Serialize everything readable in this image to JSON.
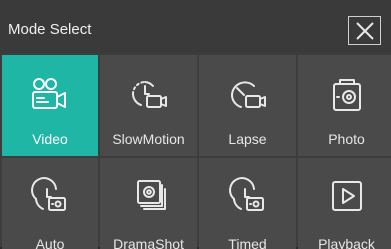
{
  "header": {
    "title": "Mode Select",
    "close_icon": "close-icon"
  },
  "modes": [
    {
      "label": "Video",
      "icon": "video-camera-icon",
      "active": true
    },
    {
      "label": "SlowMotion",
      "icon": "slow-motion-camera-icon",
      "active": false
    },
    {
      "label": "Lapse",
      "icon": "time-lapse-camera-icon",
      "active": false
    },
    {
      "label": "Photo",
      "icon": "photo-camera-icon",
      "active": false
    },
    {
      "label": "Auto",
      "icon": "auto-timer-camera-icon",
      "active": false
    },
    {
      "label": "DramaShot",
      "icon": "drama-shot-icon",
      "active": false
    },
    {
      "label": "Timed",
      "icon": "timed-camera-icon",
      "active": false
    },
    {
      "label": "Playback",
      "icon": "playback-icon",
      "active": false
    }
  ],
  "colors": {
    "active_tile": "#1fb6a6",
    "tile": "#4a4a4a",
    "background": "#3d3d3d"
  }
}
